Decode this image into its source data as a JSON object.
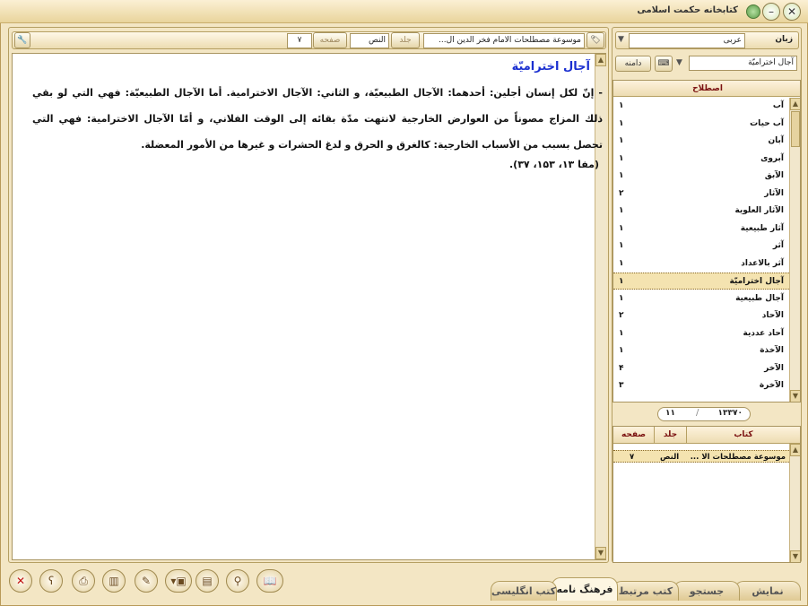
{
  "window": {
    "title": "كتابخانه حكمت اسلامی",
    "colors": {
      "accent": "#7a1010",
      "title_link": "#1a2fd0",
      "selected_row": "#f4e3b0"
    }
  },
  "left_panel": {
    "language_label": "زبان",
    "language_value": "عربی",
    "search_value": "آجال اختراميّة",
    "search_button": "دامنه",
    "list_header": "اصطلاح",
    "terms": [
      {
        "word": "آب",
        "count": "۱"
      },
      {
        "word": "آب حیات",
        "count": "۱"
      },
      {
        "word": "آبان",
        "count": "۱"
      },
      {
        "word": "آبروی",
        "count": "۱"
      },
      {
        "word": "الآبق",
        "count": "۱"
      },
      {
        "word": "الآثار",
        "count": "۲"
      },
      {
        "word": "الآثار العلوية",
        "count": "۱"
      },
      {
        "word": "آثار طبیعیة",
        "count": "۱"
      },
      {
        "word": "آثر",
        "count": "۱"
      },
      {
        "word": "آثر بالاعداد",
        "count": "۱"
      },
      {
        "word": "آجال اختراميّة",
        "count": "۱",
        "selected": true
      },
      {
        "word": "آجال طبیعیة",
        "count": "۱"
      },
      {
        "word": "الآحاد",
        "count": "۲"
      },
      {
        "word": "آحاد عددية",
        "count": "۱"
      },
      {
        "word": "الآخذة",
        "count": "۱"
      },
      {
        "word": "الآخر",
        "count": "۴"
      },
      {
        "word": "الآخرة",
        "count": "۳"
      }
    ],
    "position_value": "۱۳۳۷۰",
    "position_index": "۱۱",
    "books_headers": {
      "book": "کتاب",
      "volume": "جلد",
      "page": "صفحه"
    },
    "books": [
      {
        "book": "موسوعة مصطلحات الا ...",
        "volume": "النص",
        "page": "۷"
      }
    ]
  },
  "right_panel": {
    "book_field": "موسوعة مصطلحات الامام فخر الدين ال...",
    "volume_label": "جلد",
    "volume_value": "النص",
    "page_label": "صفحه",
    "page_value": "۷",
    "article_title": "آجال اختراميّة",
    "article_body": "- إنّ لكل إنسان أجلين: أحدهما: الآجال الطبيعيّة، و الثاني: الآجال الاخترامية. أما الآجال الطبيعيّة: فهي التي لو بقي ذلك المزاج مصوناً من العوارض الخارجية لانتهت مدّة بقائه إلى الوقت الفلاني، و أمّا الآجال الاخترامية: فهي التي تحصل بسبب من الأسباب الخارجية: كالغرق و الحرق و لدغ الحشرات و غيرها من الأمور المعضلة.",
    "article_ref": "(مفا ۱۳، ۱۵۳، ۳۷)."
  },
  "tabs": [
    {
      "label": "نمایش"
    },
    {
      "label": "جستجو"
    },
    {
      "label": "کتب مرتبط"
    },
    {
      "label": "فرهنگ نامه",
      "active": true
    },
    {
      "label": "کتب انگلیسی"
    }
  ]
}
